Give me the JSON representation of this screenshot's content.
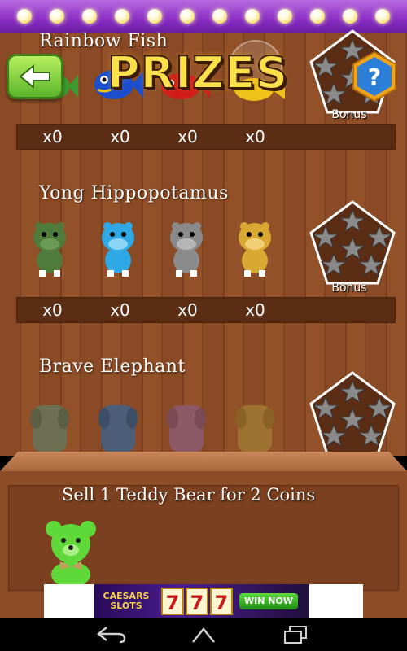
{
  "header": {
    "title": "PRIZES",
    "back_icon": "back-arrow-icon",
    "help_label": "?"
  },
  "sections": [
    {
      "name": "Rainbow Fish",
      "counts": [
        "x0",
        "x0",
        "x0",
        "x0"
      ],
      "bonus_label": "Bonus",
      "colors": [
        "#3c9a2e",
        "#1c4fd0",
        "#d21c1c",
        "#f0c21c"
      ]
    },
    {
      "name": "Yong Hippopotamus",
      "counts": [
        "x0",
        "x0",
        "x0",
        "x0"
      ],
      "bonus_label": "Bonus",
      "colors": [
        "#4f7c3c",
        "#2fa9e6",
        "#8a8a8a",
        "#d8a832"
      ]
    },
    {
      "name": "Brave Elephant",
      "colors": [
        "#6d6f52",
        "#4d5e79",
        "#8c5a66",
        "#9e7332"
      ]
    }
  ],
  "shelf": {
    "sell_text": "Sell 1 Teddy Bear for 2 Coins",
    "bear_color": "#5fd83a"
  },
  "ad": {
    "brand": "CAESARS SLOTS",
    "reels": [
      "7",
      "7",
      "7"
    ],
    "cta": "WIN NOW"
  },
  "navbar": {
    "back_icon": "nav-back-icon",
    "home_icon": "nav-home-icon",
    "recents_icon": "nav-recents-icon"
  }
}
